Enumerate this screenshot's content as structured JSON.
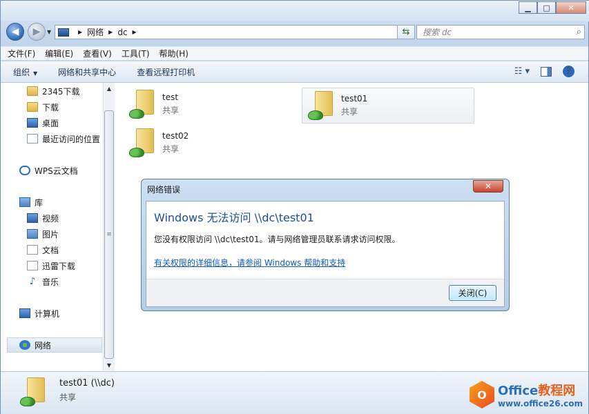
{
  "nav": {
    "address_crumbs": [
      "网络",
      "dc"
    ],
    "search_placeholder": "搜索 dc"
  },
  "menu": [
    "文件(F)",
    "编辑(E)",
    "查看(V)",
    "工具(T)",
    "帮助(H)"
  ],
  "commands": {
    "organize": "组织",
    "network_center": "网络和共享中心",
    "remote_printers": "查看远程打印机"
  },
  "sidebar": {
    "items": [
      {
        "label": "2345下载",
        "icon": "folder-icon"
      },
      {
        "label": "下载",
        "icon": "downloads-icon"
      },
      {
        "label": "桌面",
        "icon": "desktop-icon"
      },
      {
        "label": "最近访问的位置",
        "icon": "recent-places-icon"
      },
      {
        "label": "WPS云文档",
        "icon": "cloud-icon"
      },
      {
        "label": "库",
        "icon": "library-icon"
      },
      {
        "label": "视频",
        "icon": "video-icon"
      },
      {
        "label": "图片",
        "icon": "pictures-icon"
      },
      {
        "label": "文档",
        "icon": "documents-icon"
      },
      {
        "label": "迅雷下载",
        "icon": "thunder-download-icon"
      },
      {
        "label": "音乐",
        "icon": "music-icon"
      },
      {
        "label": "计算机",
        "icon": "computer-icon"
      },
      {
        "label": "网络",
        "icon": "network-icon"
      }
    ]
  },
  "content": {
    "shares": [
      {
        "name": "test",
        "sub": "共享"
      },
      {
        "name": "test01",
        "sub": "共享"
      },
      {
        "name": "test02",
        "sub": "共享"
      }
    ]
  },
  "details": {
    "name": "test01 (\\\\dc)",
    "sub": "共享"
  },
  "watermark": {
    "logo_letter": "O",
    "title_en": "Office",
    "title_cn": "教程网",
    "url": "www.office26.com"
  },
  "dialog": {
    "title": "网络错误",
    "heading": "Windows 无法访问 \\\\dc\\test01",
    "message": "您没有权限访问 \\\\dc\\test01。请与网络管理员联系请求访问权限。",
    "link": "有关权限的详细信息，请参阅 Windows 帮助和支持",
    "close_button": "关闭(C)"
  }
}
